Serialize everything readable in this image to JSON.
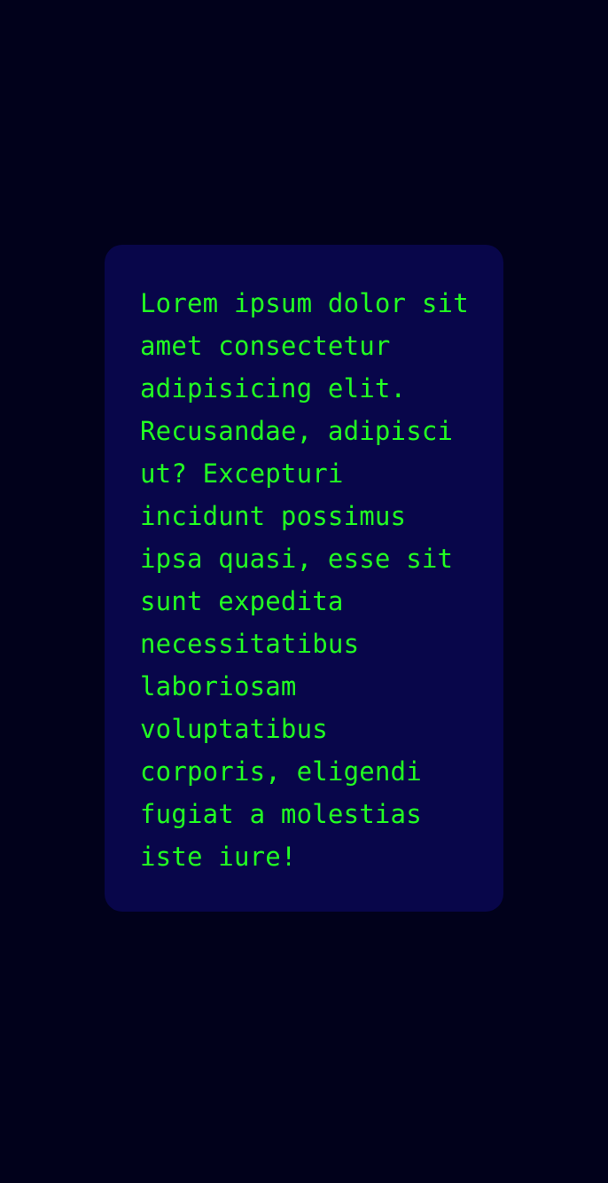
{
  "card": {
    "lines": [
      "Lorem ipsum dolor sit",
      "amet consectetur",
      "adipisicing elit.",
      "Recusandae, adipisci",
      "ut? Excepturi",
      "incidunt possimus",
      "ipsa quasi, esse sit",
      "sunt expedita",
      "necessitatibus",
      "laboriosam",
      "voluptatibus",
      "corporis, eligendi",
      "fugiat a molestias",
      "iste iure!"
    ]
  },
  "colors": {
    "page_background": "#01011b",
    "card_background": "#08064a",
    "text": "#22ff22"
  }
}
